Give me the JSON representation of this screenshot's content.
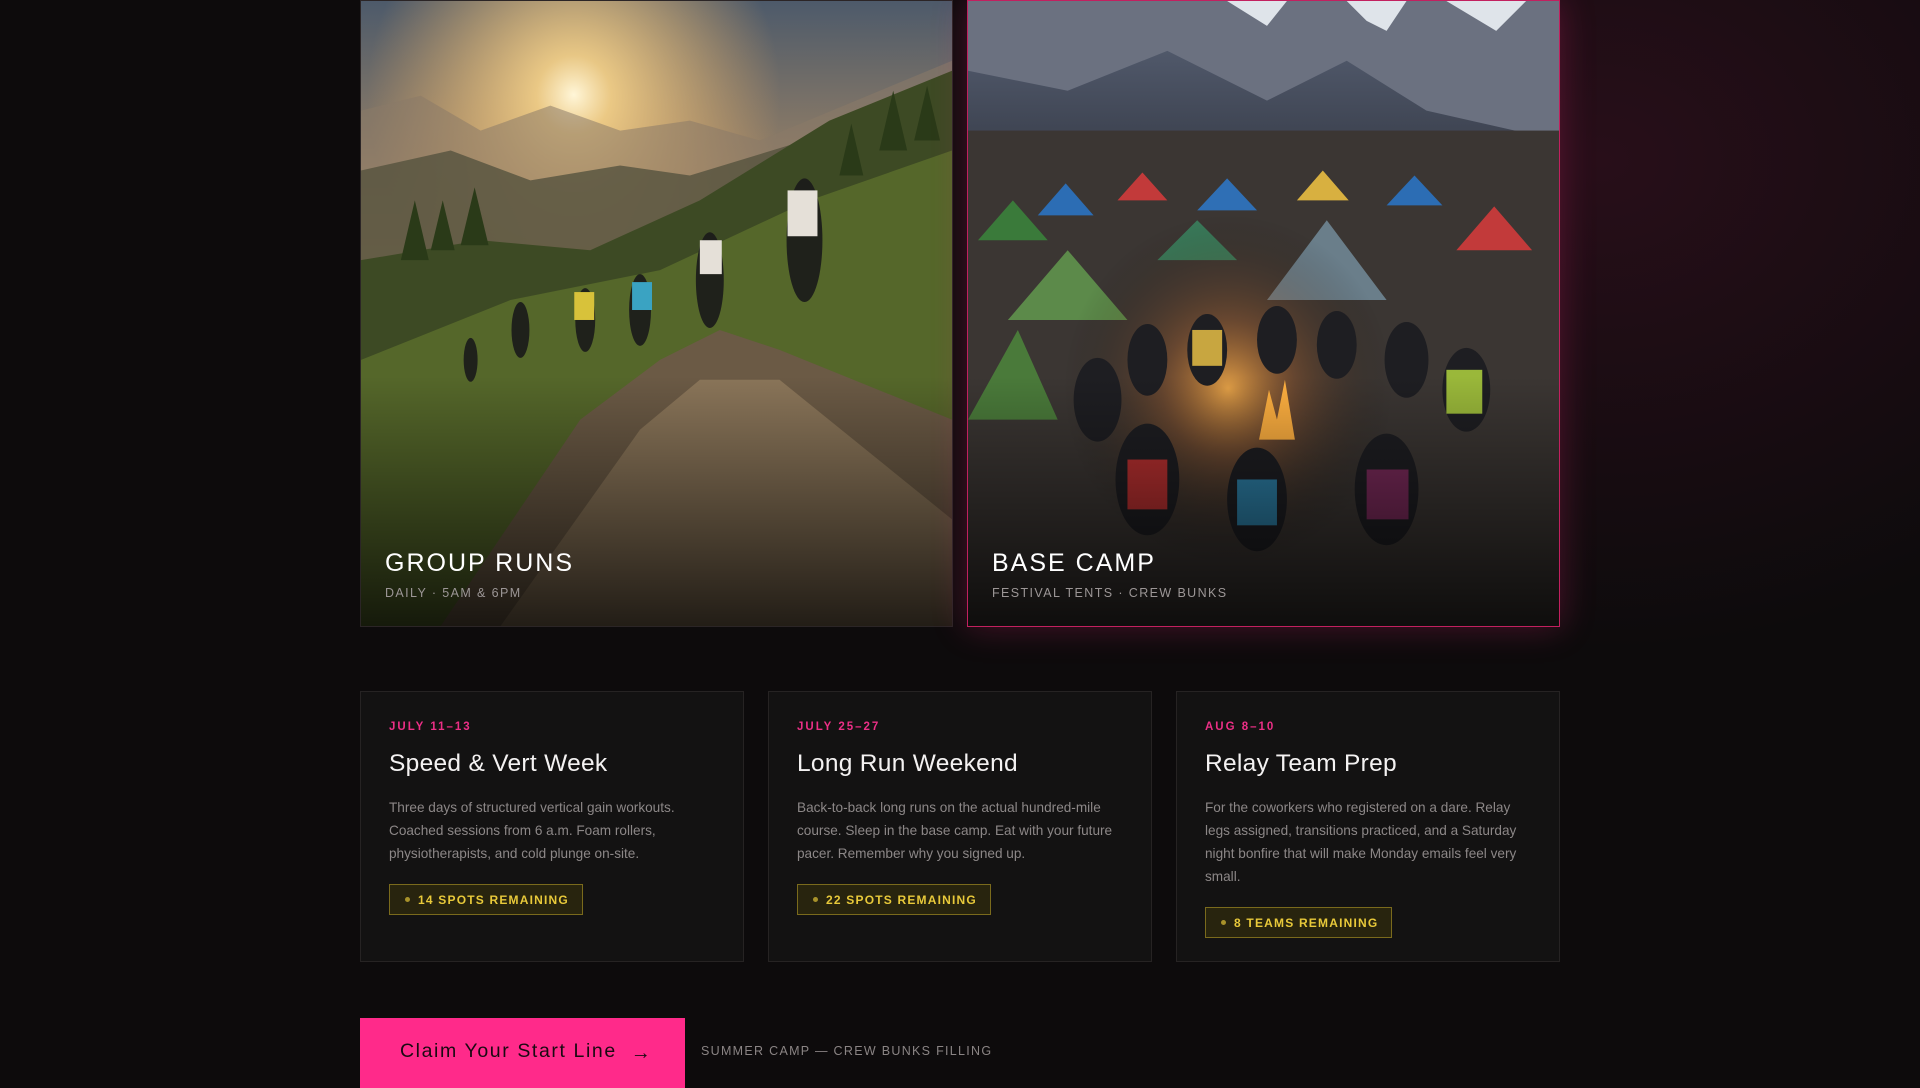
{
  "photo_cards": [
    {
      "title": "GROUP RUNS",
      "subtitle": "DAILY · 5AM & 6PM",
      "image": "trail-runners-sunrise"
    },
    {
      "title": "BASE CAMP",
      "subtitle": "FESTIVAL TENTS · CREW BUNKS",
      "image": "campfire-tents-mountains"
    }
  ],
  "events": [
    {
      "date": "JULY 11–13",
      "title": "Speed & Vert Week",
      "description": "Three days of structured vertical gain workouts. Coached sessions from 6 a.m. Foam rollers, physiotherapists, and cold plunge on-site.",
      "badge": "14 SPOTS REMAINING"
    },
    {
      "date": "JULY 25–27",
      "title": "Long Run Weekend",
      "description": "Back-to-back long runs on the actual hundred-mile course. Sleep in the base camp. Eat with your future pacer. Remember why you signed up.",
      "badge": "22 SPOTS REMAINING"
    },
    {
      "date": "AUG 8–10",
      "title": "Relay Team Prep",
      "description": "For the coworkers who registered on a dare. Relay legs assigned, transitions practiced, and a Saturday night bonfire that will make Monday emails feel very small.",
      "badge": "8 TEAMS REMAINING"
    }
  ],
  "cta": {
    "label": "Claim Your Start Line",
    "arrow": "→",
    "note": "SUMMER CAMP — CREW BUNKS FILLING"
  },
  "colors": {
    "accent_pink": "#ff2a8a",
    "date_pink": "#ec2f86",
    "badge_gold": "#e8c93a",
    "background": "#0d0b0c"
  }
}
